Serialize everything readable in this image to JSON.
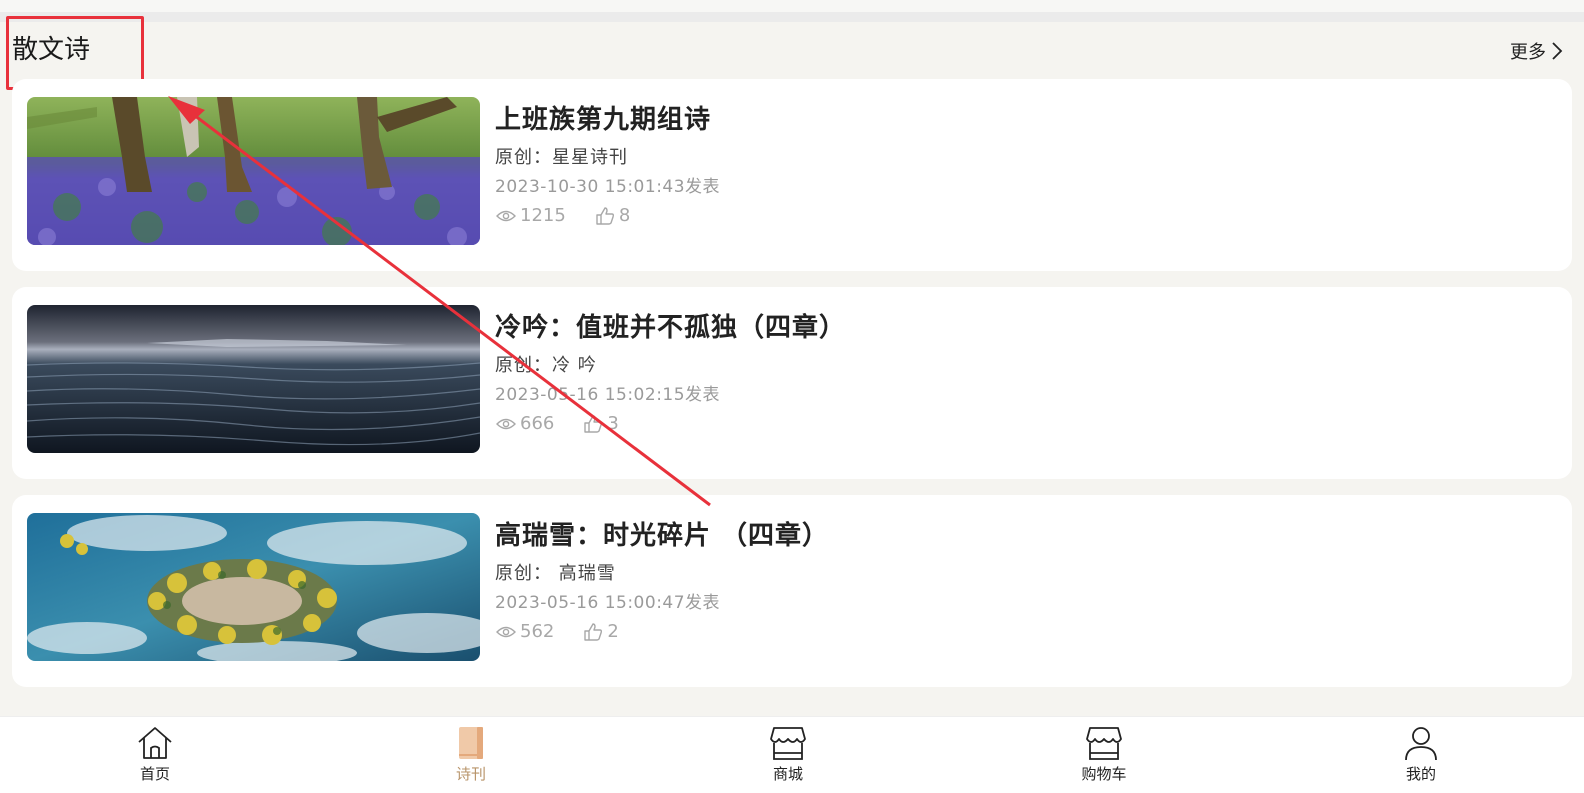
{
  "section": {
    "title": "散文诗",
    "more_label": "更多"
  },
  "articles": [
    {
      "title": "上班族第九期组诗",
      "author": "原创：星星诗刊",
      "date": "2023-10-30 15:01:43发表",
      "views": "1215",
      "likes": "8",
      "image": "bluebell-forest"
    },
    {
      "title": "冷吟：值班并不孤独（四章）",
      "author": "原创：冷 吟",
      "date": "2023-05-16 15:02:15发表",
      "views": "666",
      "likes": "3",
      "image": "dark-sea"
    },
    {
      "title": "高瑞雪：时光碎片 （四章）",
      "author": "原创： 高瑞雪",
      "date": "2023-05-16 15:00:47发表",
      "views": "562",
      "likes": "2",
      "image": "aerial-island"
    }
  ],
  "tabbar": {
    "items": [
      {
        "label": "首页",
        "icon": "home-icon",
        "active": false
      },
      {
        "label": "诗刊",
        "icon": "book-icon",
        "active": true
      },
      {
        "label": "商城",
        "icon": "store-icon",
        "active": false
      },
      {
        "label": "购物车",
        "icon": "store-icon",
        "active": false
      },
      {
        "label": "我的",
        "icon": "user-icon",
        "active": false
      }
    ]
  },
  "colors": {
    "accent": "#b8946a",
    "annotation": "#e8313b",
    "background": "#f5f4f0"
  }
}
